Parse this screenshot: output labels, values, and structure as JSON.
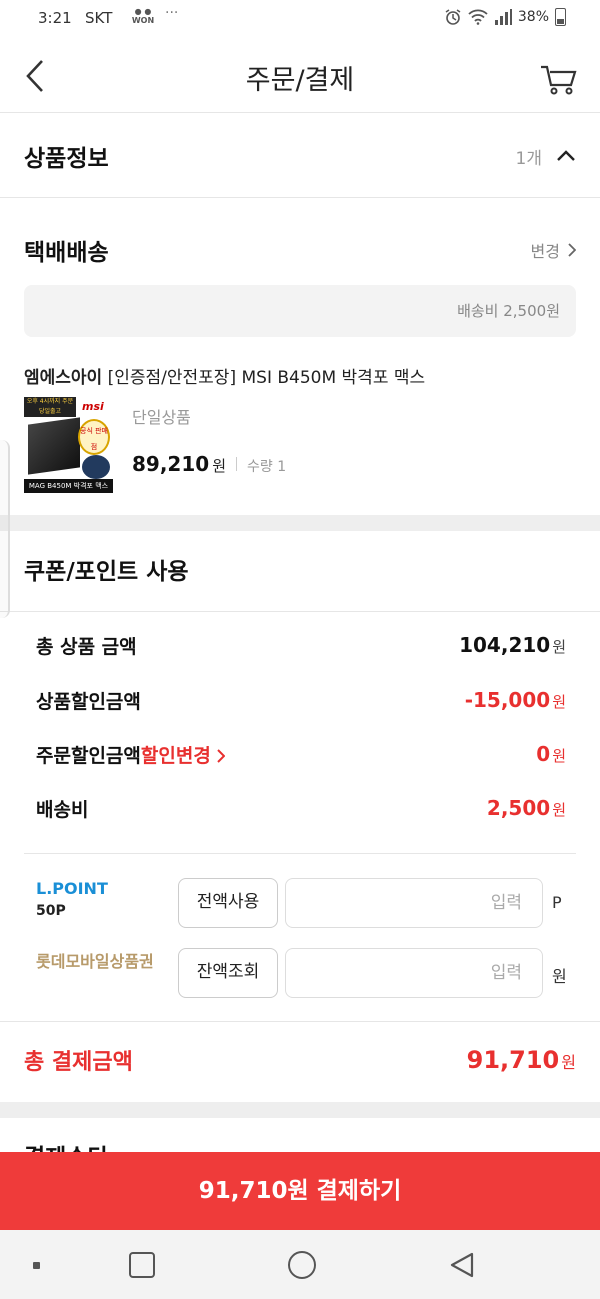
{
  "status_bar": {
    "time": "3:21",
    "carrier": "SKT",
    "won_badge": "WON",
    "dots": "···",
    "battery": "38%"
  },
  "header": {
    "title": "주문/결제"
  },
  "product_info": {
    "title": "상품정보",
    "count": "1개"
  },
  "delivery": {
    "title": "택배배송",
    "change": "변경",
    "fee_text": "배송비 2,500원",
    "product_name_prefix": "엠에스아이",
    "product_name_rest": " [인증점/안전포장] MSI B450M 박격포 맥스",
    "thumb_label": "MAG B450M 박격포 맥스",
    "thumb_brand": "msi",
    "thumb_badge_text": "오후 4시까지 주문 당일출고",
    "thumb_seal": "공식 판매점",
    "option": "단일상품",
    "price": "89,210",
    "price_unit": "원",
    "qty": "수량 1"
  },
  "coupon": {
    "title": "쿠폰/포인트 사용",
    "rows": [
      {
        "label": "총 상품 금액",
        "value": "104,210",
        "unit": "원",
        "red": false
      },
      {
        "label": "상품할인금액",
        "value": "-15,000",
        "unit": "원",
        "red": true
      },
      {
        "label": "주문할인금액",
        "link": "할인변경",
        "value": "0",
        "unit": "원",
        "red": true
      },
      {
        "label": "배송비",
        "value": "2,500",
        "unit": "원",
        "red": true
      }
    ],
    "lpoint": {
      "name": "L.POINT",
      "balance": "50P",
      "button": "전액사용",
      "placeholder": "입력",
      "unit": "P"
    },
    "gift": {
      "name": "롯데모바일상품권",
      "button": "잔액조회",
      "placeholder": "입력",
      "unit": "원"
    }
  },
  "total": {
    "label": "총 결제금액",
    "value": "91,710",
    "unit": "원"
  },
  "payment_partial": "결제수단",
  "pay_button": "91,710원 결제하기",
  "colors": {
    "accent_red": "#e8302f",
    "button_red": "#ef3b3a",
    "lpoint_blue": "#1a8fd6",
    "gift_gold": "#b79a6a"
  }
}
